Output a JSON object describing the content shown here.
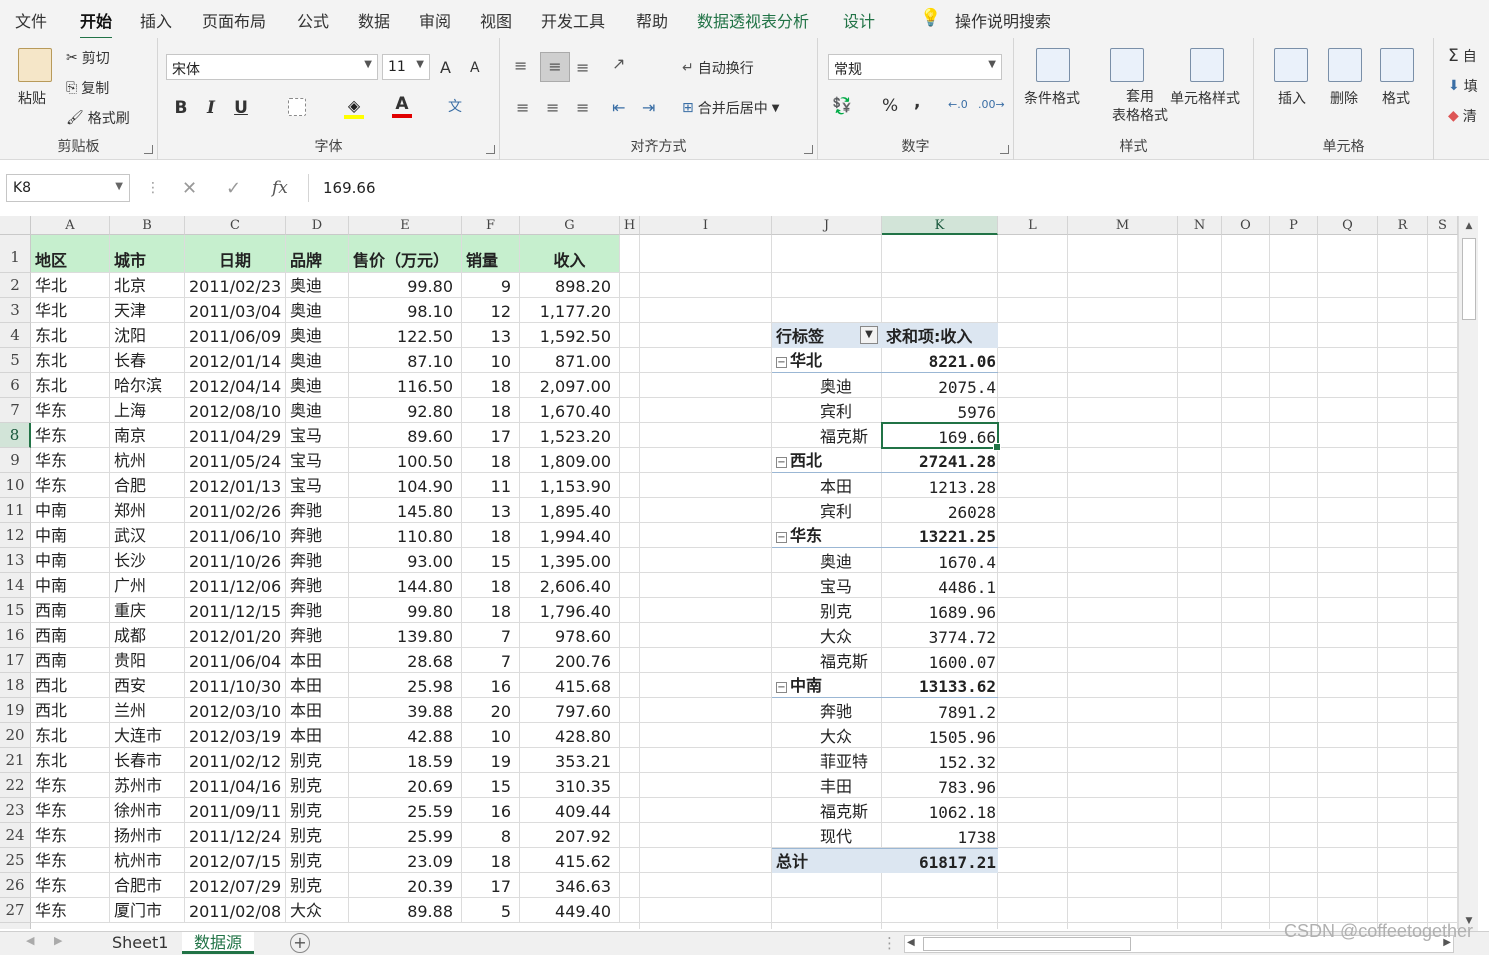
{
  "menu_tabs": [
    "文件",
    "开始",
    "插入",
    "页面布局",
    "公式",
    "数据",
    "审阅",
    "视图",
    "开发工具",
    "帮助",
    "数据透视表分析",
    "设计"
  ],
  "search_hint": "操作说明搜索",
  "ribbon": {
    "clipboard": {
      "paste": "粘贴",
      "cut": "剪切",
      "copy": "复制",
      "format_painter": "格式刷",
      "label": "剪贴板"
    },
    "font": {
      "name": "宋体",
      "size": "11",
      "grow": "A",
      "shrink": "A",
      "bold": "B",
      "italic": "I",
      "underline": "U",
      "font_color": "A",
      "label": "字体"
    },
    "alignment": {
      "wrap": "自动换行",
      "merge": "合并后居中",
      "label": "对齐方式"
    },
    "number": {
      "format": "常规",
      "percent": "%",
      "comma": ",",
      "label": "数字"
    },
    "styles": {
      "conditional": "条件格式",
      "table": "套用\n表格格式",
      "cell": "单元格样式",
      "label": "样式"
    },
    "cells": {
      "insert": "插入",
      "delete": "删除",
      "format": "格式",
      "label": "单元格"
    },
    "editing": {
      "autosum": "自",
      "fill": "填",
      "clear": "清"
    }
  },
  "formula_bar": {
    "name_box": "K8",
    "fx": "fx",
    "value": "169.66"
  },
  "columns": [
    "A",
    "B",
    "C",
    "D",
    "E",
    "F",
    "G",
    "H",
    "I",
    "J",
    "K",
    "L",
    "M",
    "N",
    "O",
    "P",
    "Q",
    "R",
    "S"
  ],
  "active_col": "K",
  "active_row": "8",
  "table": {
    "headers": [
      "地区",
      "城市",
      "日期",
      "品牌",
      "售价（万元）",
      "销量",
      "收入"
    ],
    "rows": [
      [
        "华北",
        "北京",
        "2011/02/23",
        "奥迪",
        "99.80",
        "9",
        "898.20"
      ],
      [
        "华北",
        "天津",
        "2011/03/04",
        "奥迪",
        "98.10",
        "12",
        "1,177.20"
      ],
      [
        "东北",
        "沈阳",
        "2011/06/09",
        "奥迪",
        "122.50",
        "13",
        "1,592.50"
      ],
      [
        "东北",
        "长春",
        "2012/01/14",
        "奥迪",
        "87.10",
        "10",
        "871.00"
      ],
      [
        "东北",
        "哈尔滨",
        "2012/04/14",
        "奥迪",
        "116.50",
        "18",
        "2,097.00"
      ],
      [
        "华东",
        "上海",
        "2012/08/10",
        "奥迪",
        "92.80",
        "18",
        "1,670.40"
      ],
      [
        "华东",
        "南京",
        "2011/04/29",
        "宝马",
        "89.60",
        "17",
        "1,523.20"
      ],
      [
        "华东",
        "杭州",
        "2011/05/24",
        "宝马",
        "100.50",
        "18",
        "1,809.00"
      ],
      [
        "华东",
        "合肥",
        "2012/01/13",
        "宝马",
        "104.90",
        "11",
        "1,153.90"
      ],
      [
        "中南",
        "郑州",
        "2011/02/26",
        "奔驰",
        "145.80",
        "13",
        "1,895.40"
      ],
      [
        "中南",
        "武汉",
        "2011/06/10",
        "奔驰",
        "110.80",
        "18",
        "1,994.40"
      ],
      [
        "中南",
        "长沙",
        "2011/10/26",
        "奔驰",
        "93.00",
        "15",
        "1,395.00"
      ],
      [
        "中南",
        "广州",
        "2011/12/06",
        "奔驰",
        "144.80",
        "18",
        "2,606.40"
      ],
      [
        "西南",
        "重庆",
        "2011/12/15",
        "奔驰",
        "99.80",
        "18",
        "1,796.40"
      ],
      [
        "西南",
        "成都",
        "2012/01/20",
        "奔驰",
        "139.80",
        "7",
        "978.60"
      ],
      [
        "西南",
        "贵阳",
        "2011/06/04",
        "本田",
        "28.68",
        "7",
        "200.76"
      ],
      [
        "西北",
        "西安",
        "2011/10/30",
        "本田",
        "25.98",
        "16",
        "415.68"
      ],
      [
        "西北",
        "兰州",
        "2012/03/10",
        "本田",
        "39.88",
        "20",
        "797.60"
      ],
      [
        "东北",
        "大连市",
        "2012/03/19",
        "本田",
        "42.88",
        "10",
        "428.80"
      ],
      [
        "东北",
        "长春市",
        "2011/02/12",
        "别克",
        "18.59",
        "19",
        "353.21"
      ],
      [
        "华东",
        "苏州市",
        "2011/04/16",
        "别克",
        "20.69",
        "15",
        "310.35"
      ],
      [
        "华东",
        "徐州市",
        "2011/09/11",
        "别克",
        "25.59",
        "16",
        "409.44"
      ],
      [
        "华东",
        "扬州市",
        "2011/12/24",
        "别克",
        "25.99",
        "8",
        "207.92"
      ],
      [
        "华东",
        "杭州市",
        "2012/07/15",
        "别克",
        "23.09",
        "18",
        "415.62"
      ],
      [
        "华东",
        "合肥市",
        "2012/07/29",
        "别克",
        "20.39",
        "17",
        "346.63"
      ],
      [
        "华东",
        "厦门市",
        "2011/02/08",
        "大众",
        "89.88",
        "5",
        "449.40"
      ]
    ]
  },
  "pivot": {
    "row_label": "行标签",
    "value_label": "求和项:收入",
    "rows": [
      {
        "label": "华北",
        "value": "8221.06",
        "group": true
      },
      {
        "label": "奥迪",
        "value": "2075.4"
      },
      {
        "label": "宾利",
        "value": "5976"
      },
      {
        "label": "福克斯",
        "value": "169.66"
      },
      {
        "label": "西北",
        "value": "27241.28",
        "group": true
      },
      {
        "label": "本田",
        "value": "1213.28"
      },
      {
        "label": "宾利",
        "value": "26028"
      },
      {
        "label": "华东",
        "value": "13221.25",
        "group": true
      },
      {
        "label": "奥迪",
        "value": "1670.4"
      },
      {
        "label": "宝马",
        "value": "4486.1"
      },
      {
        "label": "别克",
        "value": "1689.96"
      },
      {
        "label": "大众",
        "value": "3774.72"
      },
      {
        "label": "福克斯",
        "value": "1600.07"
      },
      {
        "label": "中南",
        "value": "13133.62",
        "group": true
      },
      {
        "label": "奔驰",
        "value": "7891.2"
      },
      {
        "label": "大众",
        "value": "1505.96"
      },
      {
        "label": "菲亚特",
        "value": "152.32"
      },
      {
        "label": "丰田",
        "value": "783.96"
      },
      {
        "label": "福克斯",
        "value": "1062.18"
      },
      {
        "label": "现代",
        "value": "1738"
      }
    ],
    "total_label": "总计",
    "total_value": "61817.21"
  },
  "sheet_tabs": [
    "Sheet1",
    "数据源"
  ],
  "add_sheet": "+",
  "watermark": "CSDN @coffeetogether",
  "colors": {
    "accent": "#217346",
    "header_fill": "#c6efce",
    "pivot_fill": "#dce6f1"
  }
}
